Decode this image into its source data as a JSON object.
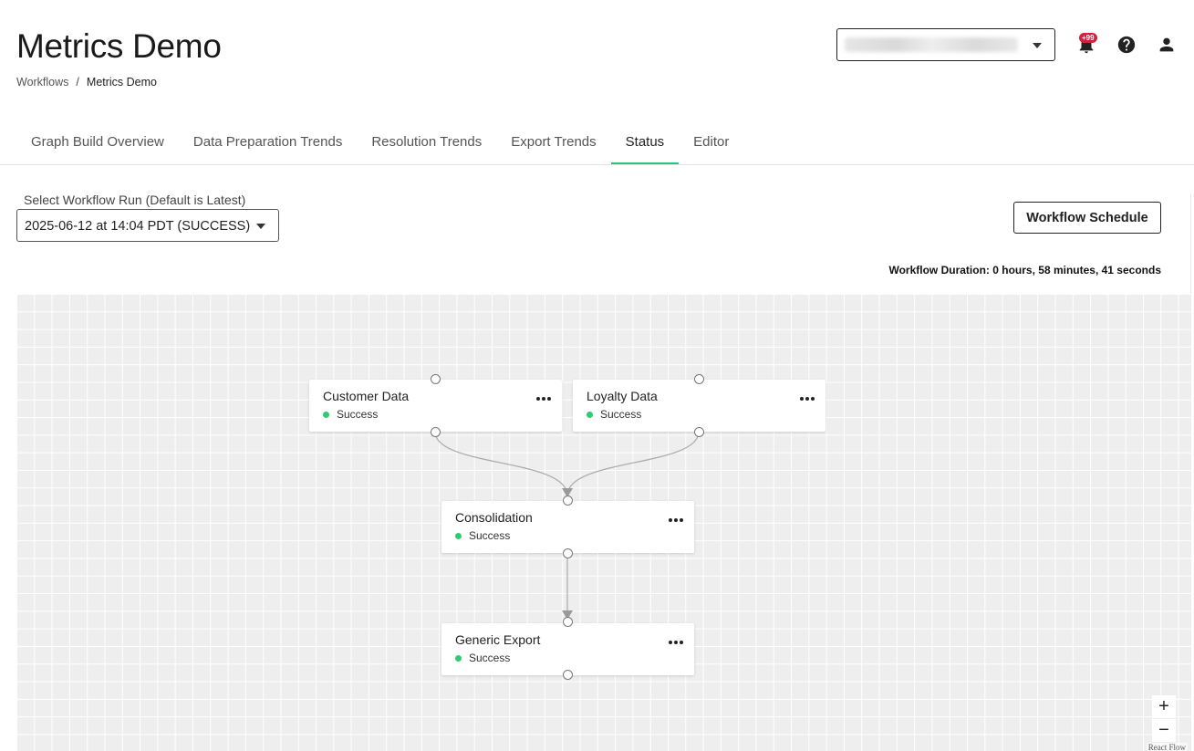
{
  "header": {
    "title": "Metrics Demo",
    "breadcrumb": [
      {
        "label": "Workflows"
      },
      {
        "label": "/"
      },
      {
        "label": "Metrics Demo"
      }
    ],
    "notifications_badge": "+99",
    "icons": [
      "bell-icon",
      "help-icon",
      "user-icon"
    ]
  },
  "tabs": [
    {
      "label": "Graph Build Overview",
      "active": false
    },
    {
      "label": "Data Preparation Trends",
      "active": false
    },
    {
      "label": "Resolution Trends",
      "active": false
    },
    {
      "label": "Export Trends",
      "active": false
    },
    {
      "label": "Status",
      "active": true
    },
    {
      "label": "Editor",
      "active": false
    }
  ],
  "run_selector": {
    "label": "Select Workflow Run (Default is Latest)",
    "value": "2025-06-12 at 14:04 PDT (SUCCESS)"
  },
  "schedule_button": "Workflow Schedule",
  "duration": "Workflow Duration: 0 hours, 58 minutes, 41 seconds",
  "nodes": [
    {
      "title": "Customer Data",
      "status": "Success"
    },
    {
      "title": "Loyalty Data",
      "status": "Success"
    },
    {
      "title": "Consolidation",
      "status": "Success"
    },
    {
      "title": "Generic Export",
      "status": "Success"
    }
  ],
  "colors": {
    "accent": "#2ec27e",
    "status_success": "#2ecc71",
    "badge": "#d0223d",
    "canvas": "#eeeeee"
  },
  "zoom_controls": {
    "zoom_in": "+",
    "zoom_out": "−"
  },
  "attribution": "React Flow"
}
